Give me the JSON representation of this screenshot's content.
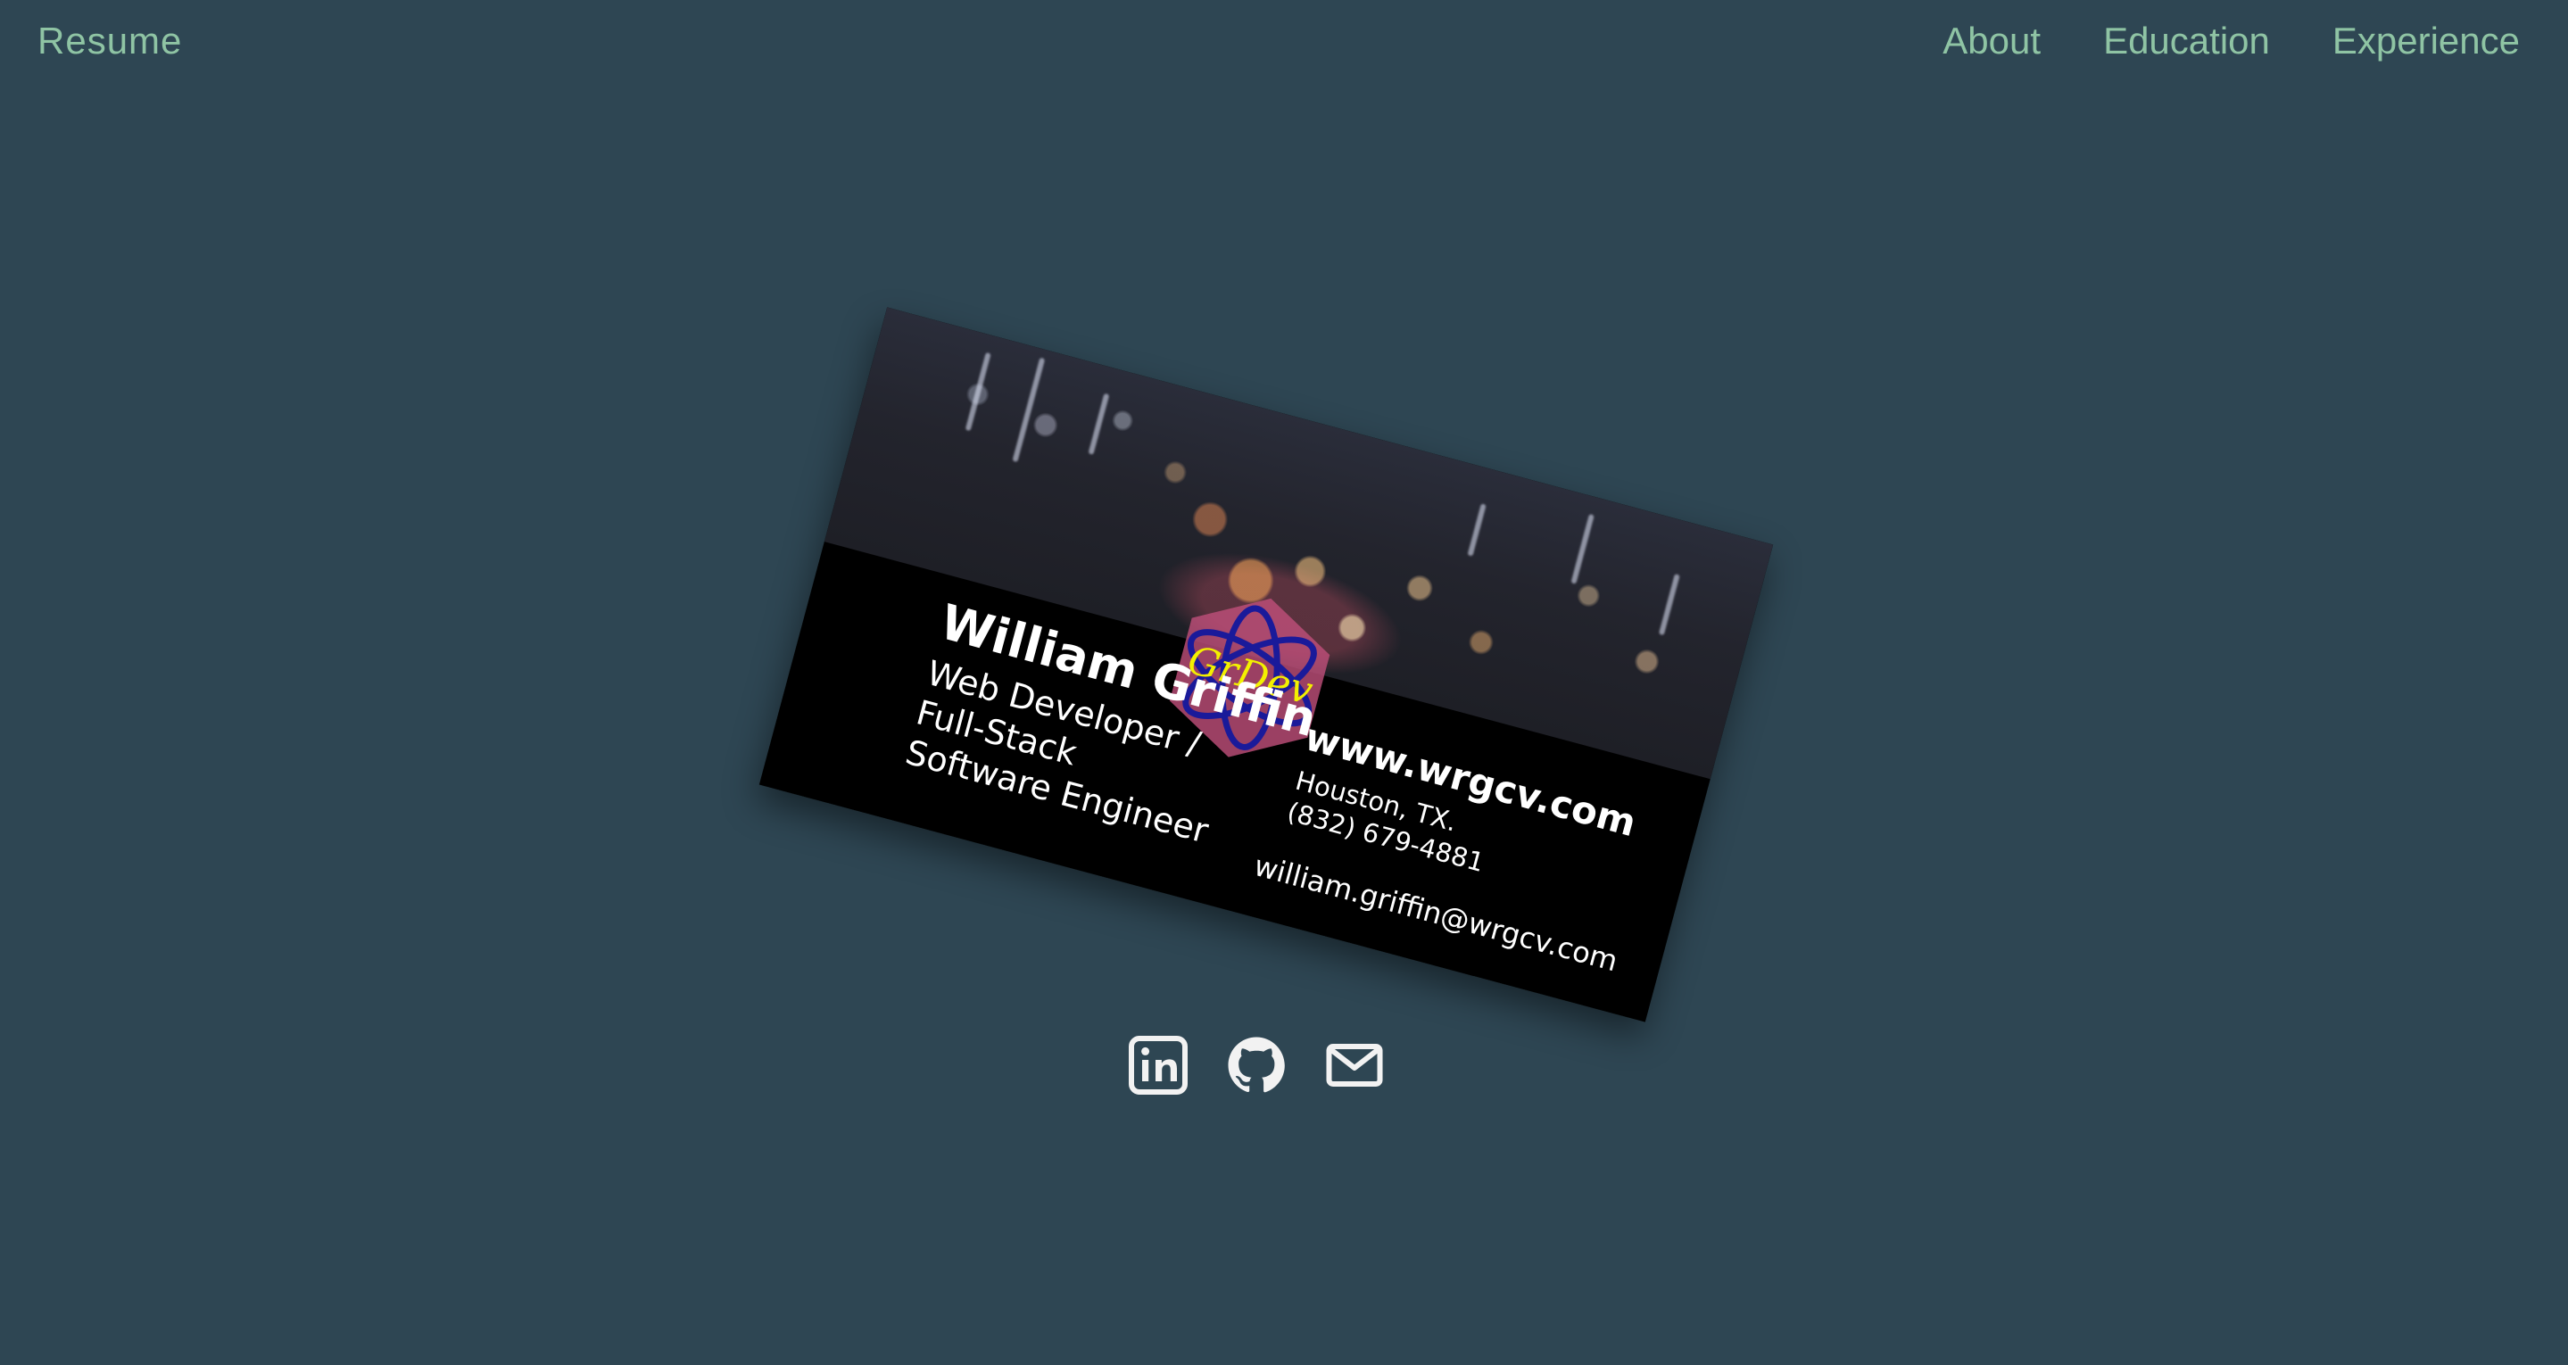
{
  "header": {
    "brand": "Resume",
    "nav": [
      {
        "label": "About"
      },
      {
        "label": "Education"
      },
      {
        "label": "Experience"
      }
    ]
  },
  "card": {
    "logo_text": "GrDev",
    "name": "William Griffin",
    "title_line1": "Web Developer /",
    "title_line2": "Full-Stack",
    "title_line3": "Software Engineer",
    "website": "www.wrgcv.com",
    "city": "Houston, TX.",
    "phone": "(832) 679-4881",
    "email": "william.griffin@wrgcv.com"
  },
  "socials": [
    {
      "icon": "linkedin-icon"
    },
    {
      "icon": "github-icon"
    },
    {
      "icon": "mail-icon"
    }
  ],
  "colors": {
    "background": "#2e4653",
    "nav_text": "#8fc4a4",
    "card_bg": "#000000",
    "logo_text": "#f3f000",
    "logo_orbit": "#1a1a9a",
    "icon_color": "#f2f2f2"
  }
}
